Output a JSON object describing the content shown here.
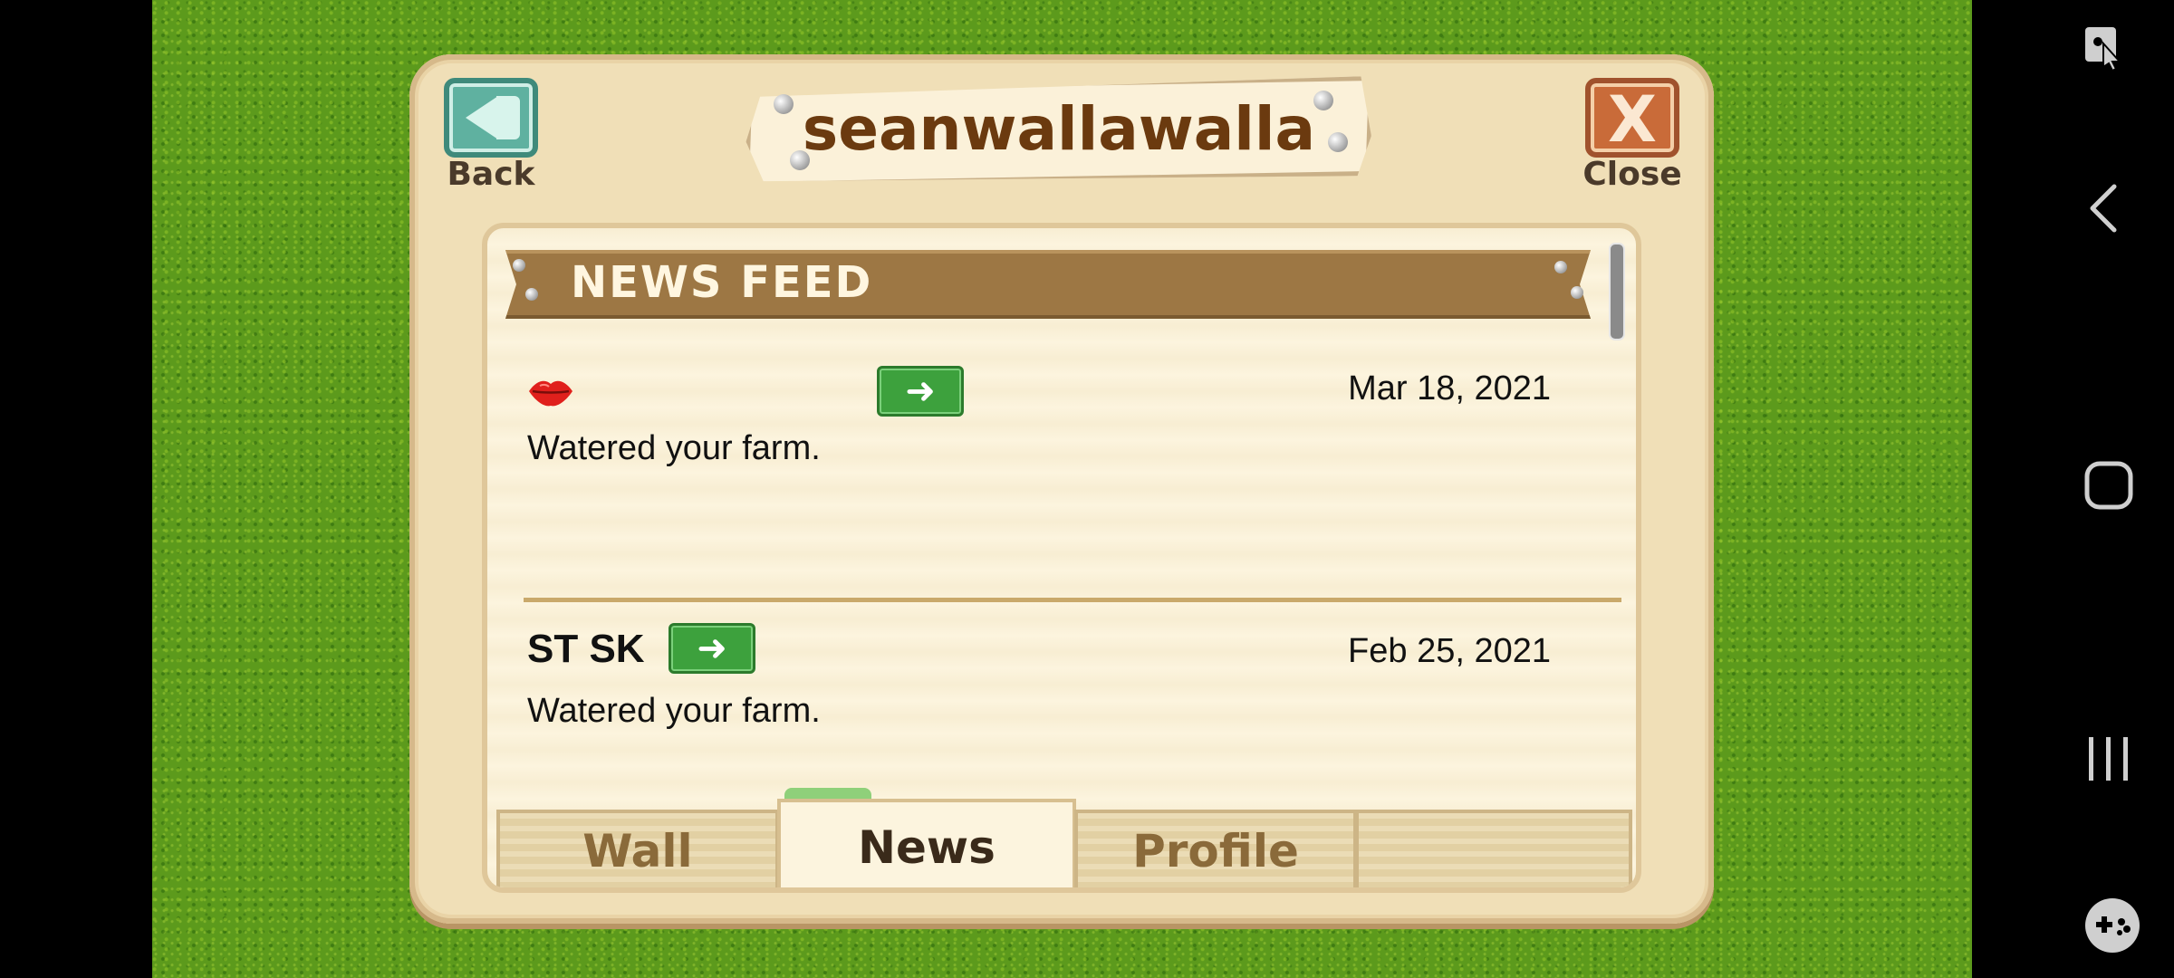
{
  "dialog": {
    "title": "seanwallawalla",
    "back_label": "Back",
    "close_label": "Close",
    "close_glyph": "X"
  },
  "news_feed": {
    "header": "NEWS FEED",
    "items": [
      {
        "name": "",
        "name_icon": "lips-icon",
        "date": "Mar 18, 2021",
        "text": "Watered your farm.",
        "go_icon": "arrow-right-icon"
      },
      {
        "name": "ST SK",
        "date": "Feb 25, 2021",
        "text": "Watered your farm.",
        "go_icon": "arrow-right-icon"
      }
    ]
  },
  "tabs": [
    {
      "label": "Wall"
    },
    {
      "label": "News",
      "selected": true
    },
    {
      "label": "Profile"
    },
    {
      "label": ""
    }
  ],
  "system_nav": {
    "icons": [
      "accessibility-icon",
      "back-icon",
      "home-icon",
      "recents-icon",
      "game-launcher-icon"
    ]
  },
  "colors": {
    "grass": "#5c9a1c",
    "dialog_bg": "#f0dfb7",
    "banner": "#9d7744",
    "go_button": "#3da13d",
    "title_text": "#6b3a0f"
  }
}
